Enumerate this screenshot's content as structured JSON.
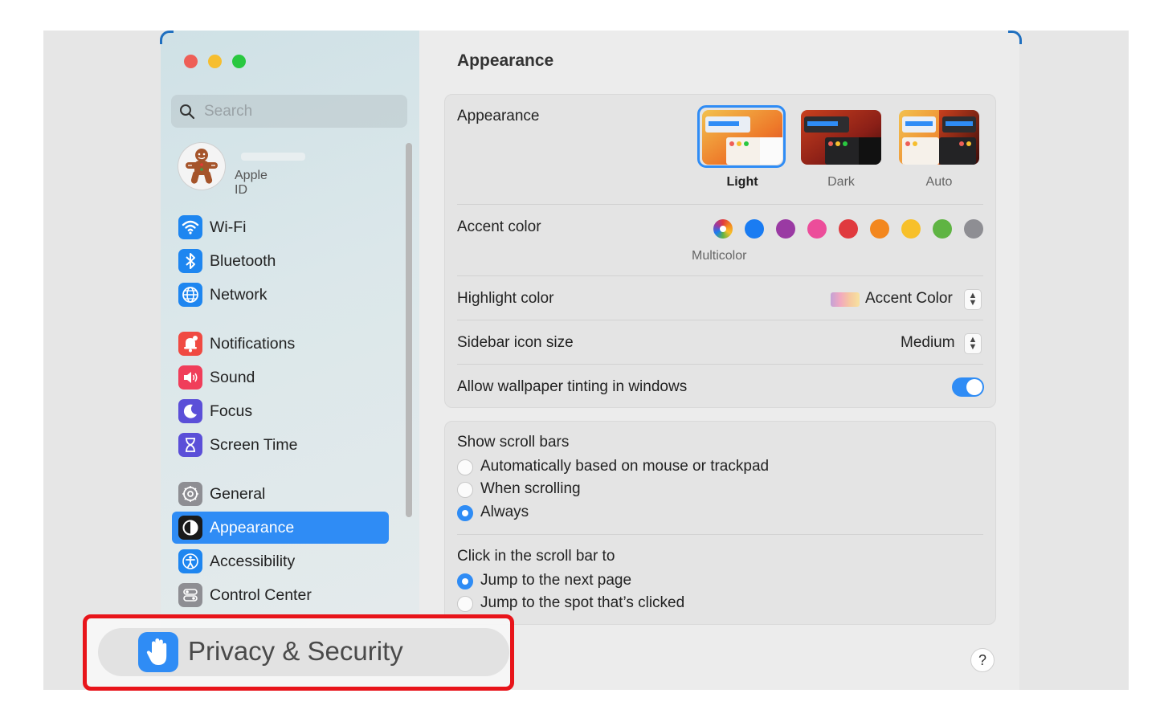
{
  "sidebar": {
    "search_placeholder": "Search",
    "apple_id_label": "Apple ID",
    "items": [
      {
        "label": "Wi-Fi",
        "icon": "wifi-icon"
      },
      {
        "label": "Bluetooth",
        "icon": "bluetooth-icon"
      },
      {
        "label": "Network",
        "icon": "globe-icon"
      },
      {
        "label": "Notifications",
        "icon": "bell-icon"
      },
      {
        "label": "Sound",
        "icon": "speaker-icon"
      },
      {
        "label": "Focus",
        "icon": "moon-icon"
      },
      {
        "label": "Screen Time",
        "icon": "hourglass-icon"
      },
      {
        "label": "General",
        "icon": "gear-icon"
      },
      {
        "label": "Appearance",
        "icon": "appearance-icon",
        "selected": true
      },
      {
        "label": "Accessibility",
        "icon": "accessibility-icon"
      },
      {
        "label": "Control Center",
        "icon": "toggles-icon"
      }
    ]
  },
  "main": {
    "title": "Appearance",
    "appearance": {
      "label": "Appearance",
      "options": [
        {
          "label": "Light",
          "selected": true
        },
        {
          "label": "Dark"
        },
        {
          "label": "Auto"
        }
      ]
    },
    "accent": {
      "label": "Accent color",
      "swatches": [
        "#multicolor",
        "#1a7cf2",
        "#9a3aa3",
        "#ec4d9a",
        "#e03a3e",
        "#f3871e",
        "#f7c02a",
        "#5fb443",
        "#8e8e93"
      ],
      "selected_caption": "Multicolor"
    },
    "highlight": {
      "label": "Highlight color",
      "value": "Accent Color"
    },
    "sidebar_icon_size": {
      "label": "Sidebar icon size",
      "value": "Medium"
    },
    "wallpaper_tinting": {
      "label": "Allow wallpaper tinting in windows",
      "enabled": true
    },
    "scroll_bars": {
      "label": "Show scroll bars",
      "options": [
        {
          "label": "Automatically based on mouse or trackpad",
          "selected": false
        },
        {
          "label": "When scrolling",
          "selected": false
        },
        {
          "label": "Always",
          "selected": true
        }
      ]
    },
    "click_scroll": {
      "label": "Click in the scroll bar to",
      "options": [
        {
          "label": "Jump to the next page",
          "selected": true
        },
        {
          "label": "Jump to the spot that’s clicked",
          "selected": false
        }
      ]
    },
    "help": "?"
  },
  "callout": {
    "label": "Privacy & Security",
    "icon": "hand-icon",
    "highlight_color": "#e8141a"
  }
}
